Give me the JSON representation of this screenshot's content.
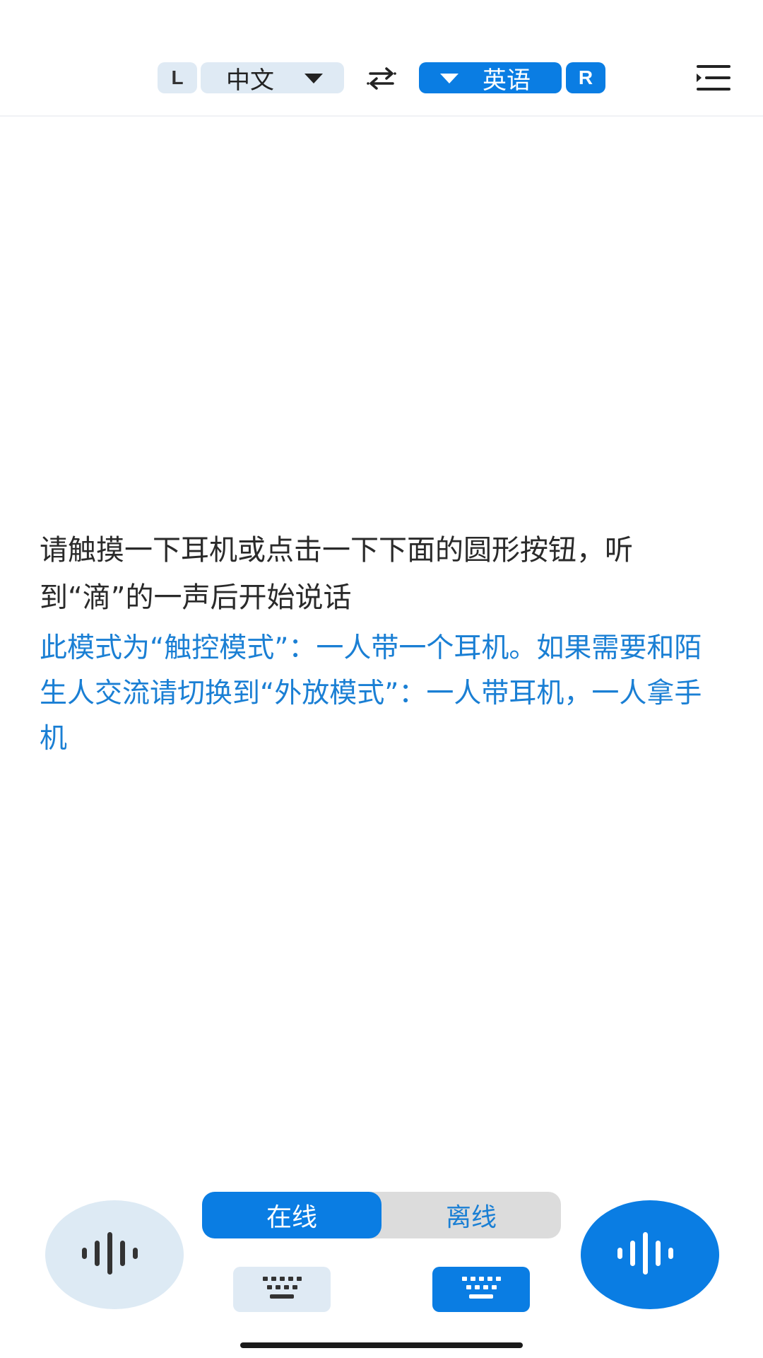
{
  "header": {
    "left_badge": "L",
    "right_badge": "R",
    "source_language": "中文",
    "target_language": "英语",
    "swap_icon": "swap-arrows-icon",
    "menu_icon": "menu-icon"
  },
  "messages": {
    "prompt": "请触摸一下耳机或点击一下下面的圆形按钮，听到“滴”的一声后开始说话",
    "mode_hint": "此模式为“触控模式”：一人带一个耳机。如果需要和陌生人交流请切换到“外放模式”：一人带耳机，一人拿手机"
  },
  "bottom": {
    "mode_toggle": {
      "online_label": "在线",
      "offline_label": "离线",
      "selected": "在线"
    },
    "left_voice_icon": "waveform-icon",
    "right_voice_icon": "waveform-icon",
    "left_keyboard_icon": "keyboard-icon",
    "right_keyboard_icon": "keyboard-icon"
  },
  "colors": {
    "accent": "#0a7de3",
    "accent_text": "#1a7fd4",
    "light_accent": "#dfeaf4",
    "toggle_track": "#dcdcdc",
    "body_text": "#2a2a2a"
  }
}
